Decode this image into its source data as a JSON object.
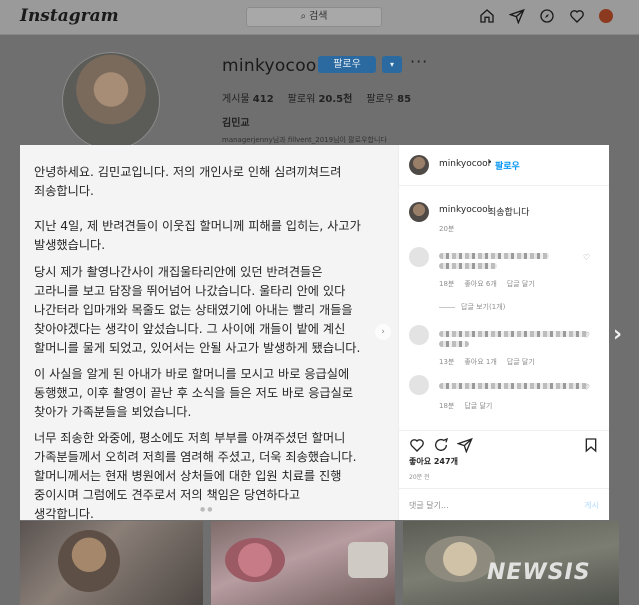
{
  "topnav": {
    "logo": "Instagram",
    "search_placeholder": "검색",
    "icons": [
      "home-icon",
      "direct-icon",
      "explore-icon",
      "heart-icon",
      "profile-avatar"
    ]
  },
  "profile": {
    "username": "minkyocool",
    "follow_label": "팔로우",
    "dropdown_label": "▾",
    "more_label": "···",
    "stats": {
      "posts_label": "게시물",
      "posts_value": "412",
      "followers_label": "팔로워",
      "followers_value": "20.5천",
      "following_label": "팔로우",
      "following_value": "85"
    },
    "full_name": "김민교",
    "bio": "managerjenny님과 fillvent_2019님이 팔로우합니다"
  },
  "post_text": {
    "paragraphs": [
      [
        "안녕하세요. 김민교입니다. 저의 개인사로 인해 심려끼쳐드려",
        "죄송합니다."
      ],
      [
        "지난 4일, 제 반려견들이 이웃집 할머니께 피해를 입히는, 사고가",
        "발생했습니다."
      ],
      [
        "당시 제가 촬영나간사이 개집울타리안에 있던 반려견들은",
        "고라니를 보고 담장을 뛰어넘어 나갔습니다. 울타리 안에 있다",
        "나간터라 입마개와 목줄도 없는 상태였기에 아내는 빨리 개들을",
        "찾아야겠다는 생각이 앞섰습니다. 그 사이에 개들이 밭에 계신",
        "할머니를 물게 되었고, 있어서는 안될 사고가 발생하게 됐습니다."
      ],
      [
        "이 사실을 알게 된 아내가 바로 할머니를 모시고 바로 응급실에",
        "동행했고, 이후 촬영이 끝난 후 소식을 들은 저도 바로 응급실로",
        "찾아가 가족분들을 뵈었습니다."
      ],
      [
        "너무 죄송한 와중에, 평소에도 저희 부부를 아껴주셨던 할머니",
        "가족분들께서 오히려 저희를 염려해 주셨고, 더욱 죄송했습니다.",
        "할머니께서는 현재 병원에서 상처들에 대한 입원 치료를 진행",
        "중이시며 그럼에도 견주로서 저의 책임은 당연하다고",
        "생각합니다."
      ]
    ]
  },
  "panel": {
    "header_user": "minkyocool",
    "header_dot": "•",
    "header_follow": "팔로우",
    "caption_user": "minkyocool",
    "caption_text": "죄송합니다",
    "caption_time": "20분",
    "comments": [
      {
        "time": "18분",
        "likes": "좋아요 6개",
        "reply": "답글 달기"
      },
      {
        "time": "13분",
        "likes": "좋아요 1개",
        "reply": "답글 달기"
      },
      {
        "time": "18분",
        "likes": "",
        "reply": "답글 달기"
      }
    ],
    "view_replies": "답글 보기(1개)",
    "likes_text": "좋아요 247개",
    "post_time": "20분 전",
    "comment_placeholder": "댓글 달기...",
    "post_button": "게시"
  },
  "watermark": "NEWSIS",
  "colors": {
    "accent": "#0095f6",
    "follow_button": "#2b6aa0",
    "overlay": "#6f6f6f"
  }
}
